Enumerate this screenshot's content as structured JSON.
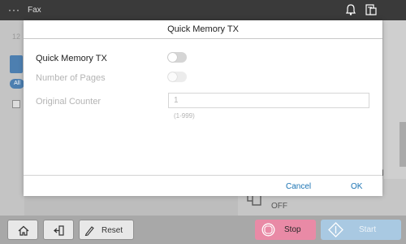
{
  "topbar": {
    "menu_icon_text": "···",
    "title": "Fax",
    "icons": [
      "bell-icon",
      "device-icon"
    ]
  },
  "background": {
    "counter_text": "12",
    "all_chip": "All",
    "right_letter": "d",
    "memory_status": "OFF"
  },
  "dialog": {
    "title": "Quick Memory TX",
    "quick_memory_label": "Quick Memory TX",
    "quick_memory_enabled": false,
    "pages_label": "Number of Pages",
    "pages_enabled": false,
    "original_counter_label": "Original Counter",
    "original_counter_value": "1",
    "original_counter_range": "(1-999)",
    "cancel_label": "Cancel",
    "ok_label": "OK"
  },
  "bottombar": {
    "reset_label": "Reset",
    "stop_label": "Stop",
    "start_label": "Start"
  },
  "colors": {
    "link": "#1a73b3",
    "stop": "#e98aa6",
    "start": "#a9c9e2",
    "accent_blue": "#4d7fb0"
  }
}
